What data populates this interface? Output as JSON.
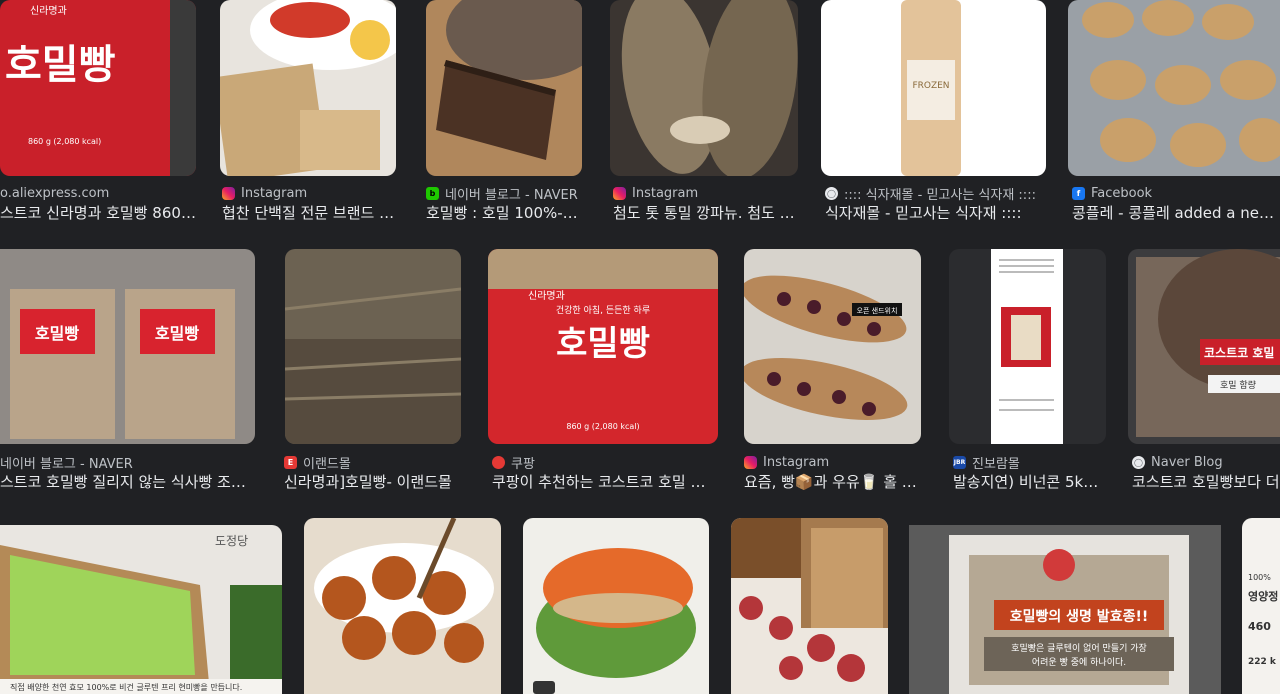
{
  "results": [
    {
      "source": "o.aliexpress.com",
      "title": "스트코 신라명과 호밀빵 860g (…",
      "icon": "none"
    },
    {
      "source": "Instagram",
      "title": "협찬 단백질 전문 브랜드 …",
      "icon": "instagram-icon"
    },
    {
      "source": "네이버 블로그 - NAVER",
      "title": "호밀빵 : 호밀 100%-…",
      "icon": "naver-blog-icon"
    },
    {
      "source": "Instagram",
      "title": "첨도 톳 통밀 깡파뉴. 첨도 …",
      "icon": "instagram-icon"
    },
    {
      "source": ":::: 식자재몰 - 믿고사는 식자재 ::::",
      "title": "식자재몰 - 믿고사는 식자재 ::::",
      "icon": "globe-icon"
    },
    {
      "source": "Facebook",
      "title": "콩플레 - 콩플레 added a new …",
      "icon": "facebook-icon"
    },
    {
      "source": "네이버 블로그 - NAVER",
      "title": "스트코 호밀빵 질리지 않는 식사빵 조…",
      "icon": "none"
    },
    {
      "source": "이랜드몰",
      "title": "신라명과]호밀빵- 이랜드몰",
      "icon": "elandmall-icon"
    },
    {
      "source": "쿠팡",
      "title": "쿠팡이 추천하는 코스트코 호밀 …",
      "icon": "coupang-icon"
    },
    {
      "source": "Instagram",
      "title": "요즘, 빵📦과 우유🥛 홀 …",
      "icon": "instagram-icon"
    },
    {
      "source": "진보람몰",
      "title": "발송지연) 비넌콘 5k…",
      "icon": "jinboram-icon"
    },
    {
      "source": "Naver Blog",
      "title": "코스트코 호밀빵보다 더",
      "icon": "globe-icon"
    }
  ],
  "image_text": {
    "brand": "신라명과",
    "package_label": "호밀빵",
    "package_slogan": "건강한 아침, 든든한 하루",
    "package_kcal": "860 g (2,080 kcal)",
    "frozen_text": "FROZEN",
    "sandwich_tag": "오픈 샌드위치",
    "costco_banner": "코스트코 호밀",
    "costco_sub": "호밀 함량",
    "ferment_title": "호밀빵의 생명 발효종!!",
    "ferment_body1": "호밀빵은 글루텐이 없어 만들기 가장",
    "ferment_body2": "어려운 빵 중에 하나이다.",
    "avocado_caption": "직접 배양한 천연 효모 100%로 비건 글루텐 프리 현미빵을 만듭니다.",
    "avocado_brand": "도정당",
    "nut_1": "100%",
    "nut_2": "영양정",
    "nut_3": "460",
    "nut_4": "222 k"
  }
}
